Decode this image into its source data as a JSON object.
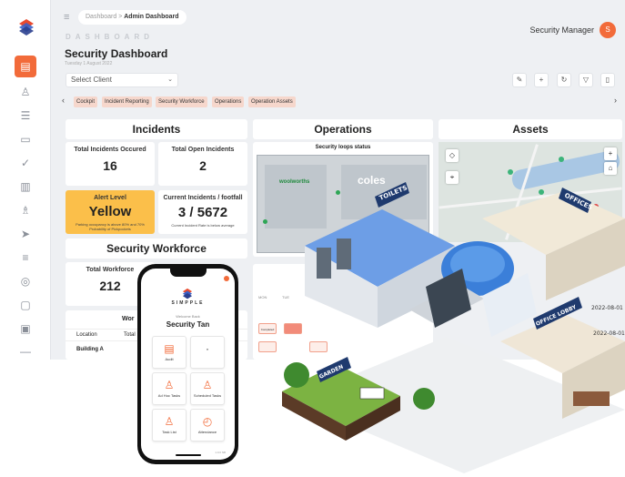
{
  "breadcrumb": {
    "root": "Dashboard",
    "current": "Admin Dashboard"
  },
  "user": {
    "role": "Security Manager",
    "initial": "S"
  },
  "header": {
    "kicker": "DASHBOARD",
    "title": "Security Dashboard",
    "date": "Tuesday 1 August 2022"
  },
  "client_select": {
    "value": "Select Client"
  },
  "tabs": [
    "Cockpit",
    "Incident Reporting",
    "Security Workforce",
    "Operations",
    "Operation Assets"
  ],
  "incidents": {
    "title": "Incidents",
    "total_occurred_label": "Total Incidents Occured",
    "total_occurred_value": "16",
    "total_open_label": "Total Open Incidents",
    "total_open_value": "2",
    "alert_label": "Alert Level",
    "alert_value": "Yellow",
    "alert_note": "Parking occupancy is above 80% and 70% Probability of Pickpockets",
    "footfall_label": "Current Incidents / footfall",
    "footfall_value": "3 / 5672",
    "footfall_note": "Current Incident Rate is below average"
  },
  "workforce": {
    "title": "Security Workforce",
    "total_label": "Total Workforce",
    "total_value": "212",
    "table_title": "Wor",
    "col_location": "Location",
    "col_total": "Total",
    "row1": "Building A"
  },
  "operations": {
    "title": "Operations",
    "loops_title": "Security loops status",
    "store_a": "woolworths",
    "store_b": "coles",
    "days": [
      "MON",
      "TUE"
    ],
    "chip_label": "Completed"
  },
  "assets": {
    "title": "Assets"
  },
  "iso": {
    "toilets": "TOILETS",
    "offices": "OFFICES",
    "lobby": "OFFICE LOBBY",
    "garden": "GARDEN",
    "date1": "2022-08-01",
    "date2": "2022-08-01"
  },
  "phone": {
    "brand": "SIMPPLE",
    "welcome": "Welcome Back",
    "name": "Security Tan",
    "tiles": [
      "Audit",
      "",
      "Ad Hoc Tasks",
      "Scheduled Tasks",
      "Task List",
      "Attendance"
    ],
    "version": "1.0.0 NB"
  },
  "colors": {
    "accent": "#f26b3a",
    "alert_yellow": "#fbbf4a",
    "tab_bg": "#f6d7cc"
  }
}
